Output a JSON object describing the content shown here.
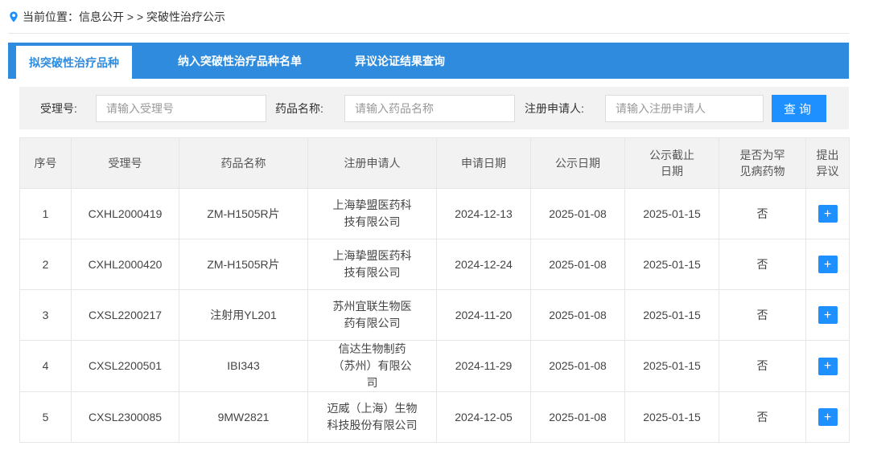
{
  "breadcrumb": {
    "prefix": "当前位置：",
    "items": [
      "信息公开",
      " > > ",
      "突破性治疗公示"
    ]
  },
  "tabs": [
    {
      "label": "拟突破性治疗品种",
      "active": true
    },
    {
      "label": "纳入突破性治疗品种名单",
      "active": false
    },
    {
      "label": "异议论证结果查询",
      "active": false
    }
  ],
  "search": {
    "accept_label": "受理号:",
    "accept_placeholder": "请输入受理号",
    "drug_label": "药品名称:",
    "drug_placeholder": "请输入药品名称",
    "applicant_label": "注册申请人:",
    "applicant_placeholder": "请输入注册申请人",
    "button_label": "查询"
  },
  "table": {
    "headers": [
      "序号",
      "受理号",
      "药品名称",
      "注册申请人",
      "申请日期",
      "公示日期",
      "公示截止日期",
      "是否为罕见病药物",
      "提出异议"
    ],
    "rows": [
      {
        "no": "1",
        "accept": "CXHL2000419",
        "drug": "ZM-H1505R片",
        "applicant": "上海挚盟医药科技有限公司",
        "apply_date": "2024-12-13",
        "publish_date": "2025-01-08",
        "deadline": "2025-01-15",
        "rare": "否",
        "action": "+"
      },
      {
        "no": "2",
        "accept": "CXHL2000420",
        "drug": "ZM-H1505R片",
        "applicant": "上海挚盟医药科技有限公司",
        "apply_date": "2024-12-24",
        "publish_date": "2025-01-08",
        "deadline": "2025-01-15",
        "rare": "否",
        "action": "+"
      },
      {
        "no": "3",
        "accept": "CXSL2200217",
        "drug": "注射用YL201",
        "applicant": "苏州宜联生物医药有限公司",
        "apply_date": "2024-11-20",
        "publish_date": "2025-01-08",
        "deadline": "2025-01-15",
        "rare": "否",
        "action": "+"
      },
      {
        "no": "4",
        "accept": "CXSL2200501",
        "drug": "IBI343",
        "applicant": "信达生物制药（苏州）有限公司",
        "apply_date": "2024-11-29",
        "publish_date": "2025-01-08",
        "deadline": "2025-01-15",
        "rare": "否",
        "action": "+"
      },
      {
        "no": "5",
        "accept": "CXSL2300085",
        "drug": "9MW2821",
        "applicant": "迈威（上海）生物科技股份有限公司",
        "apply_date": "2024-12-05",
        "publish_date": "2025-01-08",
        "deadline": "2025-01-15",
        "rare": "否",
        "action": "+"
      }
    ]
  },
  "colors": {
    "tabbar": "#2f8bde",
    "button": "#1e90ff",
    "header_bg": "#f2f2f2"
  },
  "icons": {
    "breadcrumb": "location-pin-icon",
    "objection": "plus-icon"
  }
}
